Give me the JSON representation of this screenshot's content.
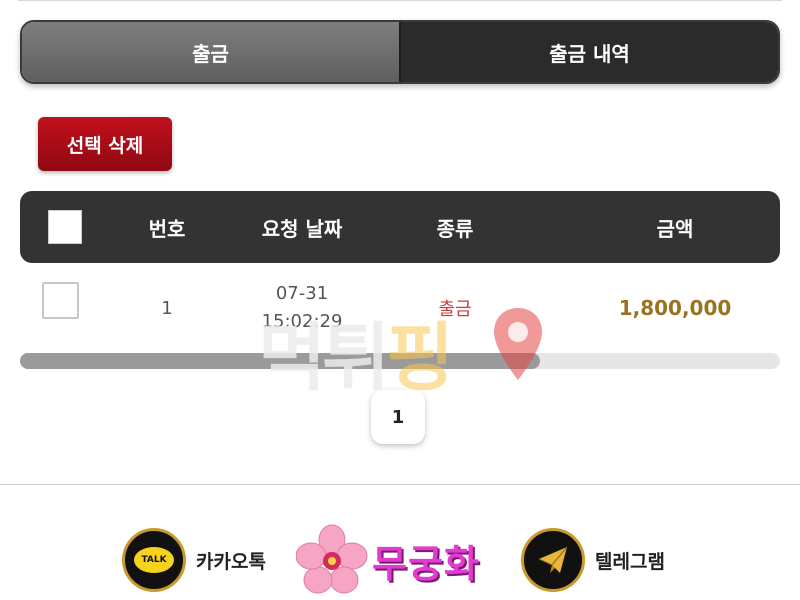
{
  "tabs": [
    {
      "label": "출금"
    },
    {
      "label": "출금 내역"
    }
  ],
  "actions": {
    "delete_selected": "선택 삭제"
  },
  "table": {
    "headers": {
      "number": "번호",
      "request_date": "요청 날짜",
      "type": "종류",
      "amount": "금액"
    },
    "rows": [
      {
        "number": "1",
        "date": "07-31",
        "time": "15:02:29",
        "type": "출금",
        "amount": "1,800,000",
        "checked": false
      }
    ]
  },
  "pagination": {
    "current_page": "1"
  },
  "footer": {
    "kakao": {
      "icon_text": "TALK",
      "label": "카카오톡"
    },
    "brand": {
      "name": "무궁화"
    },
    "telegram": {
      "label": "텔레그램"
    }
  },
  "watermark": {
    "text_a": "먹튀",
    "text_b": "핑"
  },
  "colors": {
    "delete_button": "#b00d18",
    "header_bg": "#333333",
    "amount": "#9b7320",
    "type_withdrawal": "#d23b3b",
    "brand": "#e23bd0"
  }
}
